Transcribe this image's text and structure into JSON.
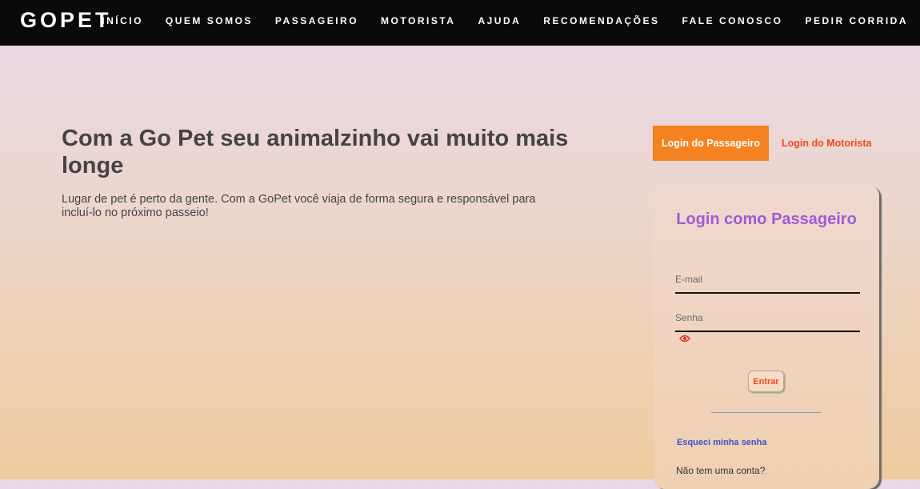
{
  "navbar": {
    "brand": "GOPET",
    "items": [
      {
        "label": "INÍCIO"
      },
      {
        "label": "QUEM SOMOS"
      },
      {
        "label": "PASSAGEIRO"
      },
      {
        "label": "MOTORISTA"
      },
      {
        "label": "AJUDA"
      },
      {
        "label": "RECOMENDAÇÕES"
      },
      {
        "label": "FALE CONOSCO"
      },
      {
        "label": "PEDIR CORRIDA"
      }
    ]
  },
  "hero": {
    "title": "Com a Go Pet seu animalzinho vai muito mais longe",
    "text": "Lugar de pet é perto da gente. Com a GoPet você viaja de forma segura e responsável para incluí-lo no próximo passeio!"
  },
  "login_tabs": {
    "passenger": "Login do Passageiro",
    "driver": "Login do Motorista"
  },
  "login_form": {
    "title": "Login como Passageiro",
    "email_placeholder": "E-mail",
    "password_placeholder": "Senha",
    "eye_icon": "eye-icon",
    "submit": "Entrar",
    "forgot": "Esqueci minha senha",
    "no_account": "Não tem uma conta?"
  },
  "colors": {
    "accent_orange": "#f58220",
    "link_red": "#ee4a1c",
    "title_purple": "#9a5ed6",
    "link_blue": "#3f4fc9",
    "navbar": "#0a0a0a"
  }
}
